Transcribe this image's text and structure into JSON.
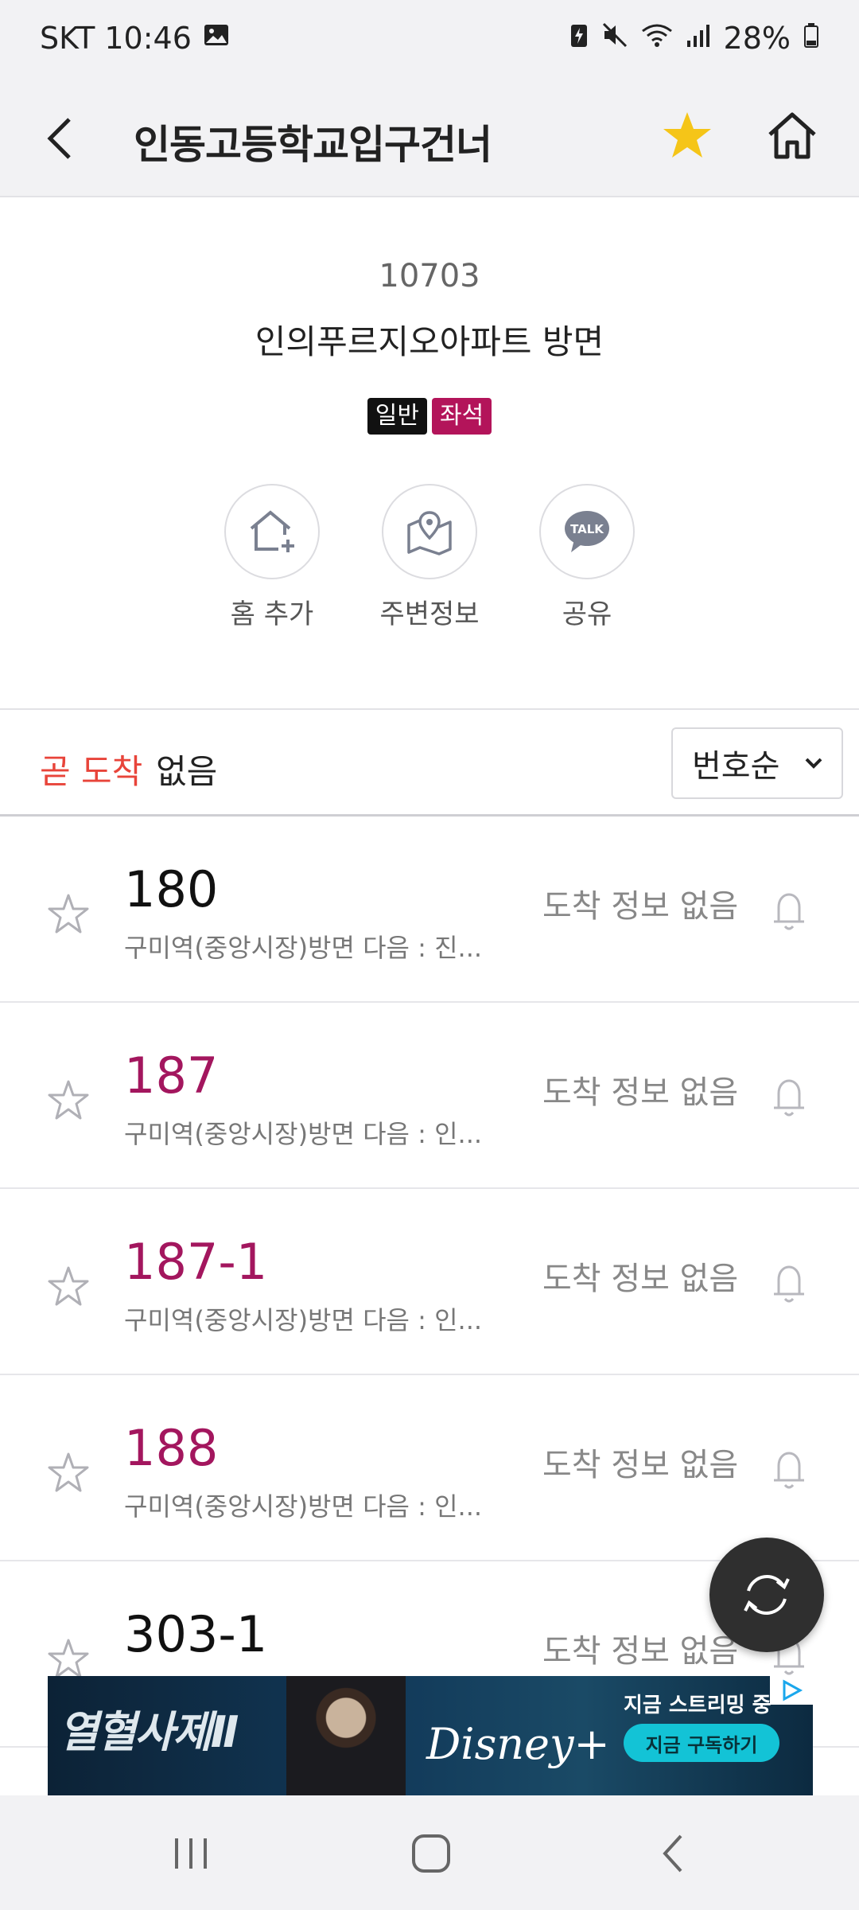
{
  "status_bar": {
    "carrier_time": "SKT 10:46",
    "battery": "28%"
  },
  "header": {
    "title": "인동고등학교입구건너"
  },
  "stop": {
    "id": "10703",
    "direction": "인의푸르지오아파트 방면",
    "badges": [
      "일반",
      "좌석"
    ]
  },
  "actions": [
    {
      "label": "홈 추가",
      "icon": "home-add-icon"
    },
    {
      "label": "주변정보",
      "icon": "map-pin-icon"
    },
    {
      "label": "공유",
      "icon": "kakaotalk-icon"
    }
  ],
  "filter": {
    "soon_label": "곧 도착",
    "soon_value": "없음",
    "sort_label": "번호순"
  },
  "buses": [
    {
      "number": "180",
      "dest": "구미역(중앙시장)방면 다음 : 진...",
      "arrival": "도착 정보 없음",
      "color": "#111111"
    },
    {
      "number": "187",
      "dest": "구미역(중앙시장)방면 다음 : 인...",
      "arrival": "도착 정보 없음",
      "color": "#a3165e"
    },
    {
      "number": "187-1",
      "dest": "구미역(중앙시장)방면 다음 : 인...",
      "arrival": "도착 정보 없음",
      "color": "#a3165e"
    },
    {
      "number": "188",
      "dest": "구미역(중앙시장)방면 다음 : 인...",
      "arrival": "도착 정보 없음",
      "color": "#a3165e"
    },
    {
      "number": "303-1",
      "dest": "",
      "arrival": "도착 정보 없음",
      "color": "#111111"
    }
  ],
  "ad": {
    "title": "열혈사제Ⅱ",
    "brand": "Disney+",
    "streaming": "지금 스트리밍 중",
    "cta": "지금 구독하기"
  },
  "colors": {
    "accent_red": "#e8443a",
    "seat_purple": "#b3145a",
    "favorite_yellow": "#f5c518"
  }
}
